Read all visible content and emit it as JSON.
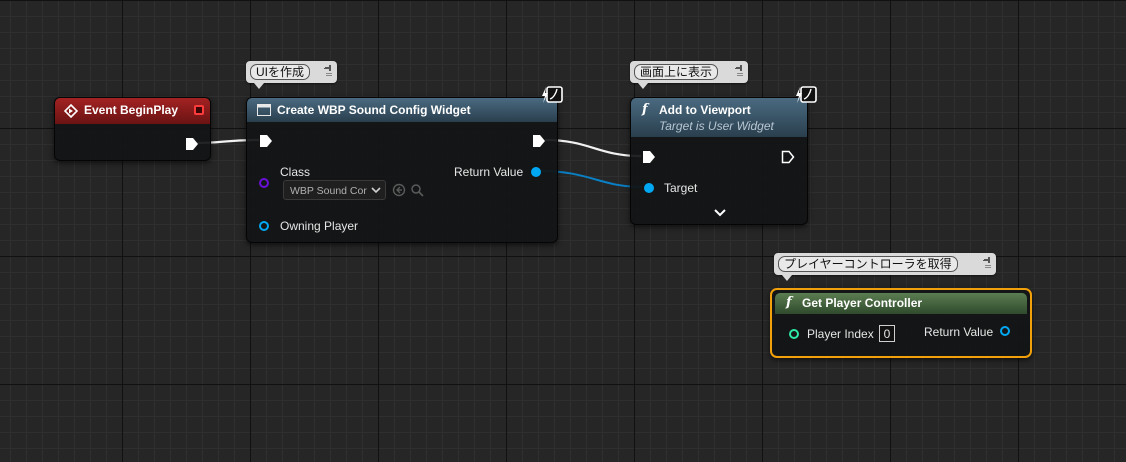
{
  "nodes": {
    "event_begin_play": {
      "title": "Event BeginPlay",
      "header_color": "#8c1b1b",
      "icon": "event-diamond-icon"
    },
    "create_widget": {
      "title": "Create WBP Sound Config Widget",
      "header_color": "#3c5a6e",
      "icon": "widget-window-icon",
      "comment": "UIを作成",
      "pins": {
        "class_label": "Class",
        "class_value": "WBP Sound Cor",
        "owning_player_label": "Owning Player",
        "return_value_label": "Return Value"
      }
    },
    "add_to_viewport": {
      "title": "Add to Viewport",
      "subtitle": "Target is User Widget",
      "header_color": "#3c5a6e",
      "icon": "function-icon",
      "comment": "画面上に表示",
      "pins": {
        "target_label": "Target"
      }
    },
    "get_player_controller": {
      "title": "Get Player Controller",
      "header_color": "#45663f",
      "icon": "function-icon",
      "comment": "プレイヤーコントローラを取得",
      "selected": true,
      "selection_color": "#f2a10a",
      "pins": {
        "player_index_label": "Player Index",
        "player_index_value": "0",
        "return_value_label": "Return Value"
      }
    }
  },
  "colors": {
    "exec_wire": "#ffffff",
    "object_pin": "#00a8f4",
    "class_pin": "#5b00c8",
    "int_pin": "#2ee8a6"
  }
}
